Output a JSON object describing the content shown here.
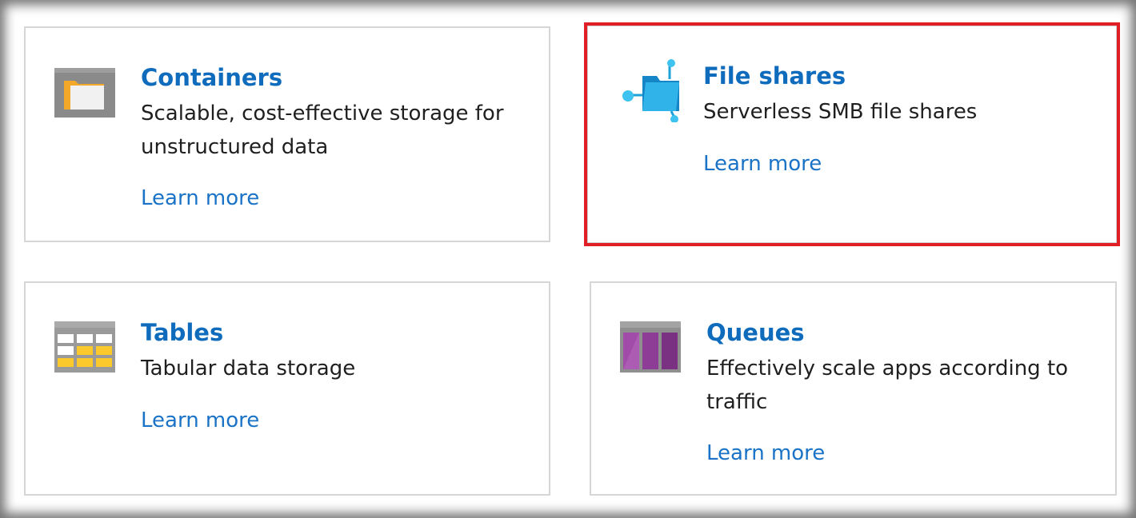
{
  "cards": [
    {
      "id": "containers",
      "icon": "containers-icon",
      "title": "Containers",
      "description": "Scalable, cost-effective storage for unstructured data",
      "link": "Learn more",
      "highlighted": false
    },
    {
      "id": "file-shares",
      "icon": "file-shares-icon",
      "title": "File shares",
      "description": "Serverless SMB file shares",
      "link": "Learn more",
      "highlighted": true
    },
    {
      "id": "tables",
      "icon": "tables-icon",
      "title": "Tables",
      "description": "Tabular data storage",
      "link": "Learn more",
      "highlighted": false
    },
    {
      "id": "queues",
      "icon": "queues-icon",
      "title": "Queues",
      "description": "Effectively scale apps according to traffic",
      "link": "Learn more",
      "highlighted": false
    }
  ],
  "colors": {
    "title": "#0f6cbd",
    "link": "#1a73c7",
    "highlight": "#e01e26"
  }
}
